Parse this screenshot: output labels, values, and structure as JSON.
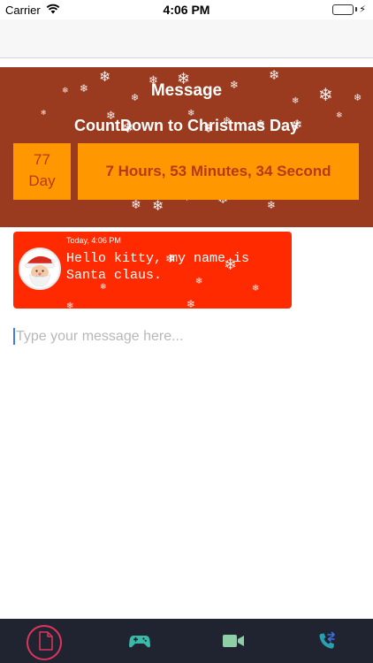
{
  "status_bar": {
    "carrier": "Carrier",
    "time": "4:06 PM",
    "battery_color": "#4cd964"
  },
  "banner": {
    "title": "Message",
    "subtitle": "CountDown to Christmas Day",
    "days_value": "77",
    "days_label": "Day",
    "time_remaining": "7 Hours, 53 Minutes, 34 Second",
    "background_color": "#9a3a1e",
    "box_color": "#ff9800",
    "box_text_color": "#b43a14"
  },
  "message": {
    "timestamp": "Today, 4:06 PM",
    "text": "Hello kitty, my name is Santa claus.",
    "avatar": "santa-claus-avatar",
    "bubble_color": "#ff2a00"
  },
  "composer": {
    "placeholder": "Type your message here..."
  },
  "tabbar": {
    "background_color": "#1f2430",
    "active_ring_color": "#e0345e",
    "tabs": [
      {
        "icon": "document-icon",
        "active": true
      },
      {
        "icon": "gamepad-icon",
        "active": false
      },
      {
        "icon": "video-camera-icon",
        "active": false
      },
      {
        "icon": "phone-transfer-icon",
        "active": false
      }
    ]
  }
}
